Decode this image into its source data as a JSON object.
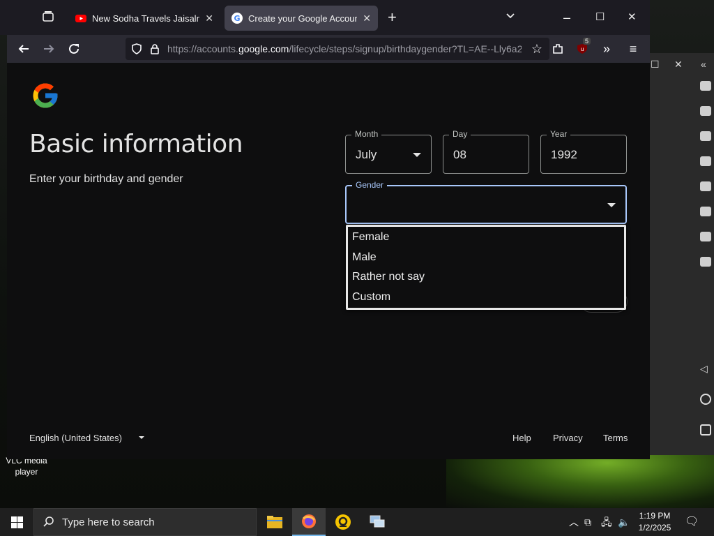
{
  "browser": {
    "tabs": [
      {
        "title": "New Sodha Travels Jaisalmer To",
        "icon": "youtube-icon",
        "active": false
      },
      {
        "title": "Create your Google Account",
        "icon": "google-icon",
        "active": true
      }
    ],
    "url_prefix": "https://accounts.",
    "url_domain": "google.com",
    "url_path": "/lifecycle/steps/signup/birthdaygender?TL=AE--Lly6a2",
    "extension_badge": "5"
  },
  "page": {
    "title": "Basic information",
    "subtitle": "Enter your birthday and gender",
    "month": {
      "label": "Month",
      "value": "July"
    },
    "day": {
      "label": "Day",
      "value": "08"
    },
    "year": {
      "label": "Year",
      "value": "1992"
    },
    "gender": {
      "label": "Gender",
      "value": "",
      "options": [
        "Female",
        "Male",
        "Rather not say",
        "Custom"
      ]
    }
  },
  "footer": {
    "language": "English (United States)",
    "links": [
      "Help",
      "Privacy",
      "Terms"
    ]
  },
  "desktop": {
    "shortcut_label_line1": "VLC media",
    "shortcut_label_line2": "player"
  },
  "taskbar": {
    "search_placeholder": "Type here to search",
    "time": "1:19 PM",
    "date": "1/2/2025"
  },
  "colors": {
    "page_bg": "#0e0e0f",
    "focus_blue": "#a8c7fa",
    "tab_active": "#42414d"
  }
}
